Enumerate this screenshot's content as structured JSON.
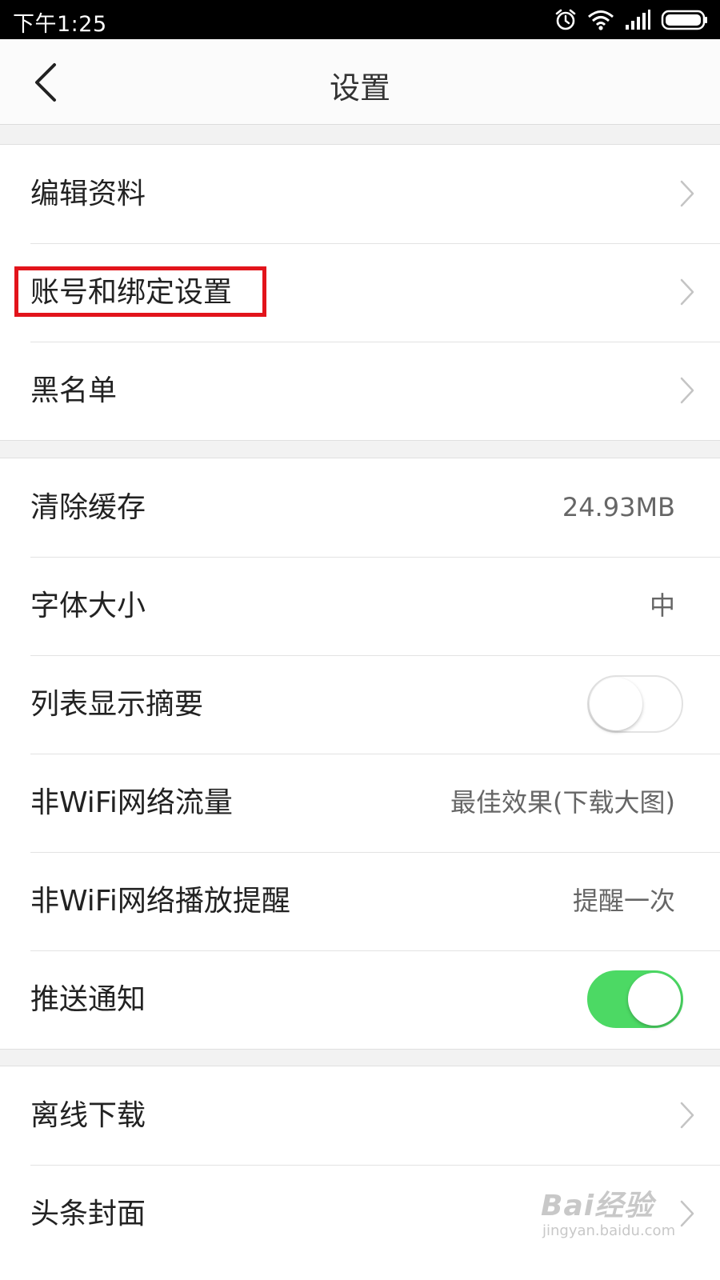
{
  "status_bar": {
    "time": "下午1:25",
    "icons": [
      "alarm-icon",
      "wifi-icon",
      "signal-icon",
      "battery-icon"
    ]
  },
  "header": {
    "title": "设置",
    "back_icon": "chevron-left-icon"
  },
  "group1": {
    "items": [
      {
        "label": "编辑资料"
      },
      {
        "label": "账号和绑定设置",
        "highlighted": true
      },
      {
        "label": "黑名单"
      }
    ]
  },
  "group2": {
    "items": [
      {
        "label": "清除缓存",
        "value": "24.93MB"
      },
      {
        "label": "字体大小",
        "value": "中"
      },
      {
        "label": "列表显示摘要",
        "toggle": false
      },
      {
        "label": "非WiFi网络流量",
        "value": "最佳效果(下载大图)"
      },
      {
        "label": "非WiFi网络播放提醒",
        "value": "提醒一次"
      },
      {
        "label": "推送通知",
        "toggle": true
      }
    ]
  },
  "group3": {
    "items": [
      {
        "label": "离线下载"
      },
      {
        "label": "头条封面"
      }
    ]
  },
  "colors": {
    "highlight_border": "#e2141b",
    "toggle_on": "#4cd964",
    "status_bar_bg": "#000000"
  },
  "watermark": {
    "main": "Bai经验",
    "sub": "jingyan.baidu.com"
  }
}
